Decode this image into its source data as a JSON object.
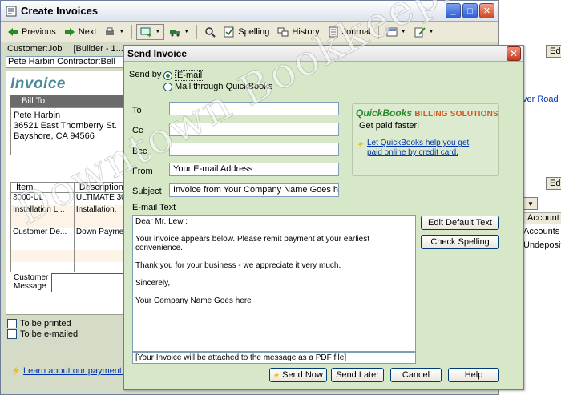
{
  "main_window": {
    "title": "Create Invoices",
    "toolbar": {
      "previous": "Previous",
      "next": "Next",
      "spelling": "Spelling",
      "history": "History",
      "journal": "Journal"
    },
    "customer_job_label": "Customer:Job",
    "template_value": "[Builder - 1...]",
    "customer_value": "Pete Harbin Contractor:Bell",
    "form_title": "Invoice",
    "bill_to": {
      "header": "Bill To",
      "lines": [
        "Pete Harbin",
        "36521 East Thornberry St.",
        "Bayshore, CA 94566"
      ]
    },
    "items": {
      "headers": [
        "Item",
        "Description"
      ],
      "rows": [
        [
          "3000-UL",
          "ULTIMATE 30"
        ],
        [
          "Installation L...",
          "Installation,"
        ],
        [
          "Customer De...",
          "Down Payme"
        ]
      ]
    },
    "customer_message_label": "Customer Message",
    "to_be_printed": "To be printed",
    "to_be_emailed": "To be e-mailed",
    "learn_link": "Learn about our payment p"
  },
  "background_window": {
    "edit_button": "Ed",
    "link_text": "ver Road",
    "edit_tab": "Edi",
    "column_header": "Account",
    "cells": [
      "Accounts R",
      "Undeposit"
    ]
  },
  "dialog": {
    "title": "Send Invoice",
    "send_by_label": "Send by",
    "option_email": "E-mail",
    "option_mail": "Mail through QuickBooks",
    "to_label": "To",
    "cc_label": "Cc",
    "bcc_label": "Bcc",
    "from_label": "From",
    "subject_label": "Subject",
    "to_value": "",
    "cc_value": "",
    "bcc_value": "",
    "from_value": "Your E-mail Address",
    "subject_value": "Invoice from Your Company Name Goes here",
    "email_text_label": "E-mail Text",
    "body": [
      "Dear Mr. Lew :",
      "Your invoice appears below.  Please remit payment at your earliest convenience.",
      "Thank you for your business - we appreciate it very much.",
      "Sincerely,",
      "Your Company Name Goes here"
    ],
    "attachment_note": "[Your Invoice will be attached to the message as a PDF file]",
    "promo": {
      "logo": "QuickBooks",
      "logo_suffix": "BILLING SOLUTIONS",
      "tagline": "Get paid faster!",
      "link": "Let QuickBooks help you get paid online by credit card."
    },
    "buttons": {
      "edit_default_text": "Edit Default Text",
      "check_spelling": "Check Spelling",
      "send_now": "Send Now",
      "send_later": "Send Later",
      "cancel": "Cancel",
      "help": "Help"
    }
  },
  "watermark": "Downtown Bookkeeping",
  "colors": {
    "dialog_bg": "#d6e8c8",
    "invoice_title": "#4a8a9a",
    "brand_green": "#2a8a2a",
    "brand_orange": "#d4541a"
  }
}
